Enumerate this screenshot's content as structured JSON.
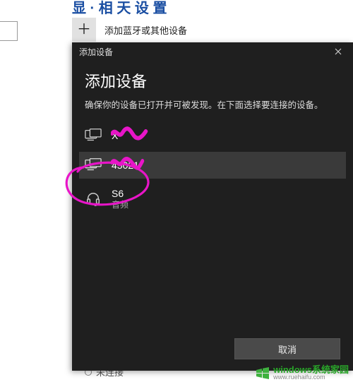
{
  "background": {
    "header_partial": "显 · 相 天 设 置",
    "add_label": "添加蓝牙或其他设备",
    "footer_status": "未连接"
  },
  "dialog": {
    "window_title": "添加设备",
    "heading": "添加设备",
    "subtext": "确保你的设备已打开并可被发现。在下面选择要连接的设备。",
    "devices": [
      {
        "name": "X",
        "sub": "",
        "selected": false
      },
      {
        "name": "45021",
        "sub": "",
        "selected": true
      },
      {
        "name": "S6",
        "sub": "音频",
        "selected": false
      }
    ],
    "cancel_label": "取消"
  },
  "watermark": {
    "cn": "windows系统家园",
    "url": "www.ruehaifu.com"
  }
}
